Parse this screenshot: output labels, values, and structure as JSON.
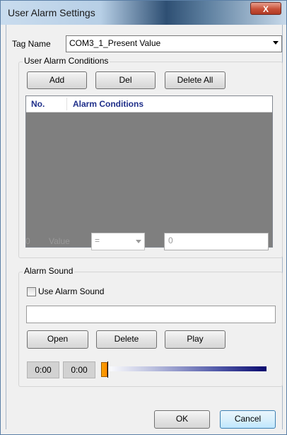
{
  "window": {
    "title": "User Alarm Settings",
    "close_glyph": "X"
  },
  "tag": {
    "label": "Tag Name",
    "value": "COM3_1_Present Value"
  },
  "conditions": {
    "group_title": "User Alarm Conditions",
    "add_label": "Add",
    "del_label": "Del",
    "delete_all_label": "Delete All",
    "columns": [
      "No.",
      "Alarm Conditions"
    ],
    "row_number": "0",
    "value_label": "Value",
    "operator": "=",
    "value": "0"
  },
  "sound": {
    "group_title": "Alarm Sound",
    "checkbox_label": "Use Alarm Sound",
    "checked": false,
    "file_path": "",
    "open_label": "Open",
    "delete_label": "Delete",
    "play_label": "Play",
    "time_current": "0:00",
    "time_total": "0:00",
    "position_fraction": 0
  },
  "footer": {
    "ok_label": "OK",
    "cancel_label": "Cancel"
  },
  "colors": {
    "header_text": "#1f2f8a",
    "list_background": "#7f7f7f",
    "slider_thumb": "#ff8a00",
    "slider_end": "#0a0a6e"
  }
}
